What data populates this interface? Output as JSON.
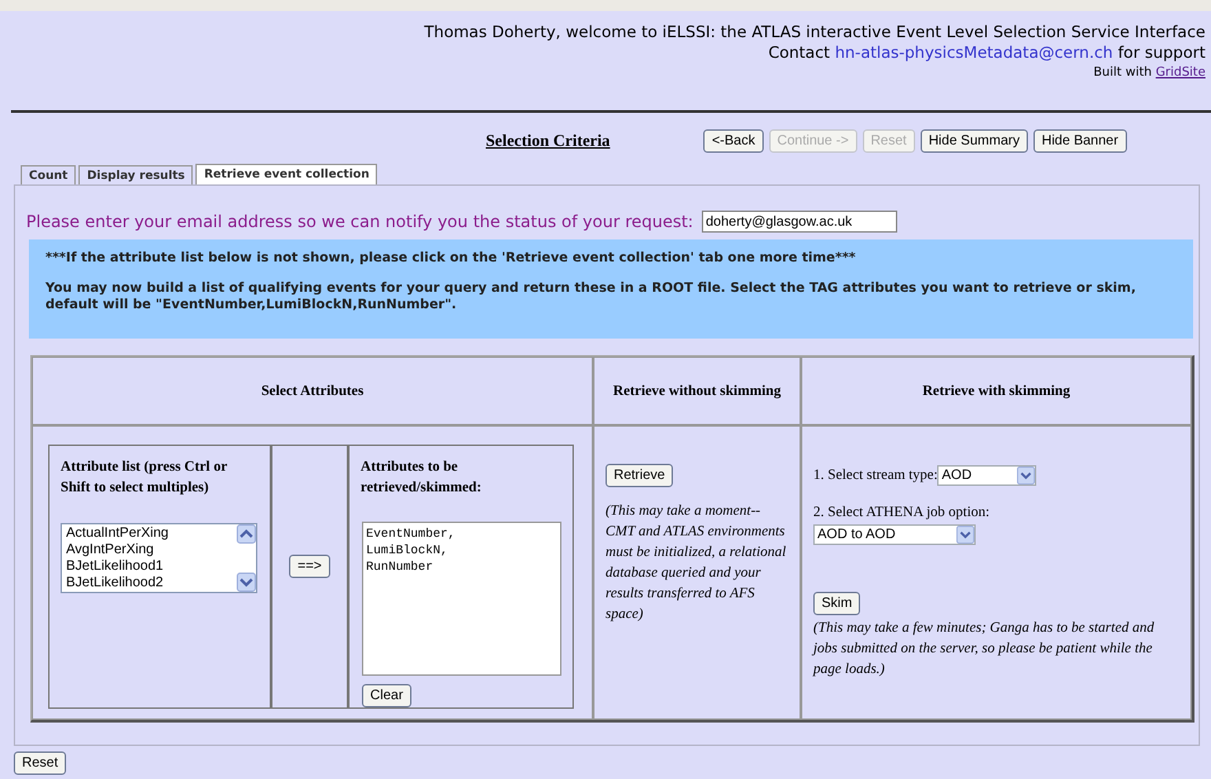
{
  "header": {
    "welcome": "Thomas Doherty, welcome to iELSSI: the ATLAS interactive Event Level Selection Service Interface",
    "contact": {
      "before": "Contact ",
      "link": "hn-atlas-physicsMetadata@cern.ch",
      "after": " for support"
    },
    "built": {
      "before": "Built with ",
      "link": "GridSite"
    }
  },
  "toolbar": {
    "title": "Selection Criteria",
    "buttons": [
      {
        "label": "<-Back",
        "disabled": false
      },
      {
        "label": "Continue ->",
        "disabled": true
      },
      {
        "label": "Reset",
        "disabled": true
      },
      {
        "label": "Hide Summary",
        "disabled": false
      },
      {
        "label": "Hide Banner",
        "disabled": false
      }
    ]
  },
  "tabs": [
    {
      "label": "Count",
      "selected": false
    },
    {
      "label": "Display results",
      "selected": false
    },
    {
      "label": "Retrieve event collection",
      "selected": true
    }
  ],
  "email": {
    "prompt": "Please enter your email address so we can notify you the status of your request:",
    "value": "doherty@glasgow.ac.uk"
  },
  "notice": [
    "***If the attribute list below is not shown, please click on the 'Retrieve event collection' tab one more time***",
    "You may now build a list of qualifying events for your query and return these in a ROOT file. Select the TAG attributes you want to retrieve or skim, default will be \"EventNumber,LumiBlockN,RunNumber\"."
  ],
  "table": {
    "headers": [
      "Select Attributes",
      "Retrieve without skimming",
      "Retrieve with skimming"
    ],
    "attributes": {
      "list_title": "Attribute list (press Ctrl or Shift to select multiples)",
      "options": [
        "ActualIntPerXing",
        "AvgIntPerXing",
        "BJetLikelihood1",
        "BJetLikelihood2"
      ],
      "move_button": "==>",
      "selected_title": "Attributes to be retrieved/skimmed:",
      "selected_value": "EventNumber,\nLumiBlockN,\nRunNumber",
      "clear_button": "Clear"
    },
    "retrieve": {
      "button": "Retrieve",
      "note": "(This may take a moment--CMT and ATLAS environments must be initialized, a relational database queried and your results transferred to AFS space)"
    },
    "skim": {
      "stream_label": "1. Select stream type:",
      "stream_value": "AOD",
      "job_label": "2. Select ATHENA job option:",
      "job_value": "AOD to AOD",
      "button": "Skim",
      "note": "(This may take a few minutes; Ganga has to be started and jobs submitted on the server, so please be patient while the page loads.)"
    }
  },
  "footer": {
    "reset_button": "Reset"
  }
}
